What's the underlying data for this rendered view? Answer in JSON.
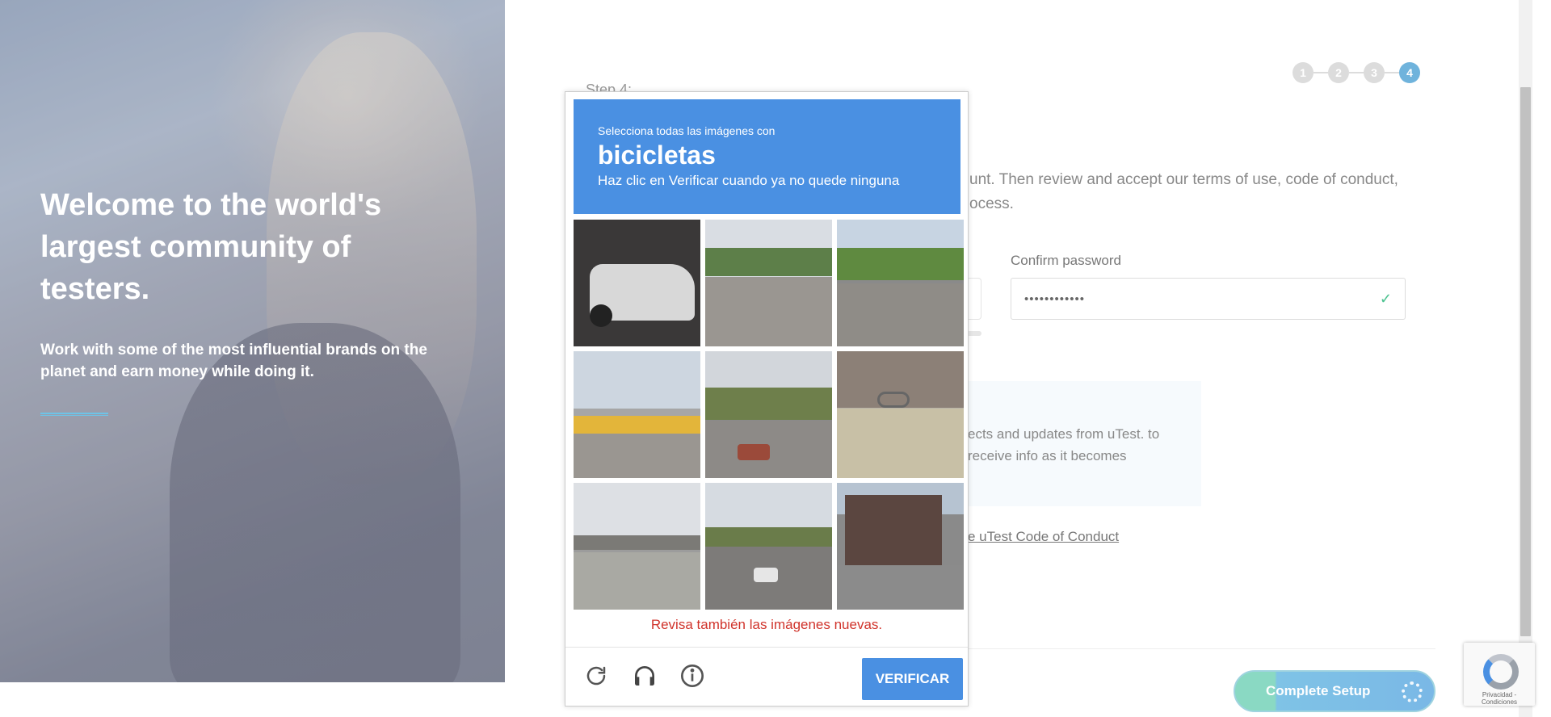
{
  "hero": {
    "title": "Welcome to the world's largest community of testers.",
    "subtitle": "Work with some of the most influential brands on the planet and earn money while doing it."
  },
  "steps": [
    "1",
    "2",
    "3",
    "4"
  ],
  "active_step": "4",
  "form": {
    "step_label": "Step 4:",
    "intro": "unt. Then review and accept our terms of use, code of conduct, ocess.",
    "confirm_password_label": "Confirm password",
    "confirm_password_value": "••••••••••••",
    "info_text": "ects and updates from uTest. to receive info as it becomes",
    "conduct_link": "e uTest Code of Conduct",
    "complete_button": "Complete Setup"
  },
  "captcha": {
    "instruction": "Selecciona todas las imágenes con",
    "keyword": "bicicletas",
    "subinstruction": "Haz clic en Verificar cuando ya no quede ninguna",
    "error_message": "Revisa también las imágenes nuevas.",
    "verify_button": "VERIFICAR",
    "icons": [
      "reload-icon",
      "headphones-icon",
      "info-icon"
    ]
  },
  "recaptcha_badge": {
    "text": "Privacidad - Condiciones"
  },
  "colors": {
    "captcha_blue": "#4a90e2",
    "error_red": "#d0332b",
    "step_active": "#6fb3dc",
    "check_green": "#4cc28f"
  }
}
